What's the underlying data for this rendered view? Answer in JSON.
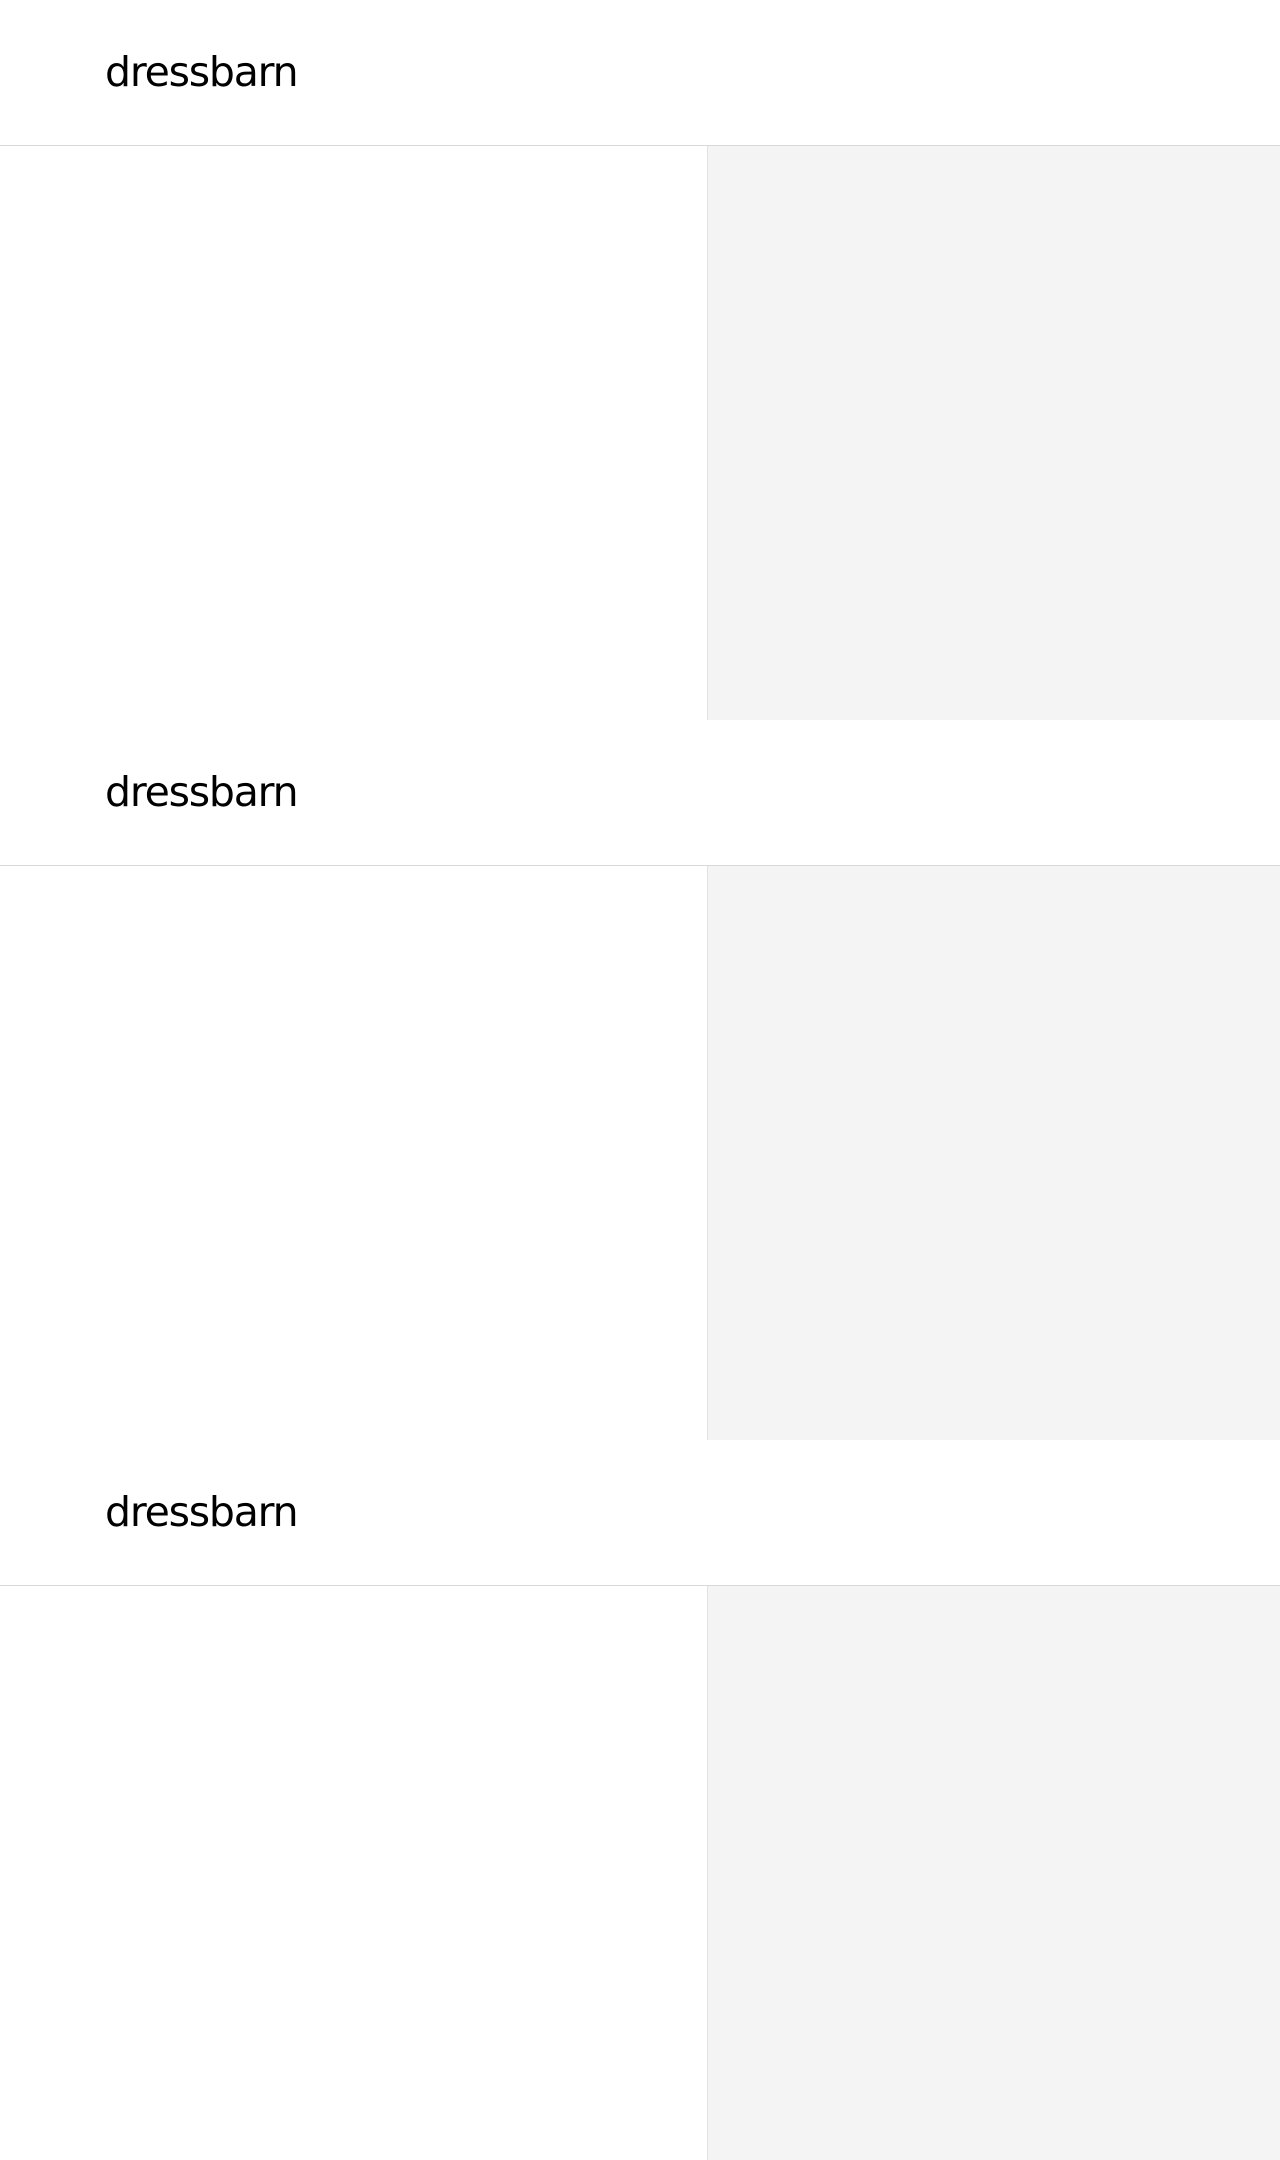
{
  "panels": [
    {
      "header": {
        "logo_text": "dressbarn"
      },
      "colors": {
        "main_bg": "#ffffff",
        "summary_bg": "#f4f4f4",
        "divider": "#d9d9d9"
      }
    },
    {
      "header": {
        "logo_text": "dressbarn"
      },
      "colors": {
        "main_bg": "#ffffff",
        "summary_bg": "#f4f4f4",
        "divider": "#d9d9d9"
      }
    },
    {
      "header": {
        "logo_text": "dressbarn"
      },
      "colors": {
        "main_bg": "#ffffff",
        "summary_bg": "#f4f4f4",
        "divider": "#d9d9d9"
      }
    }
  ]
}
